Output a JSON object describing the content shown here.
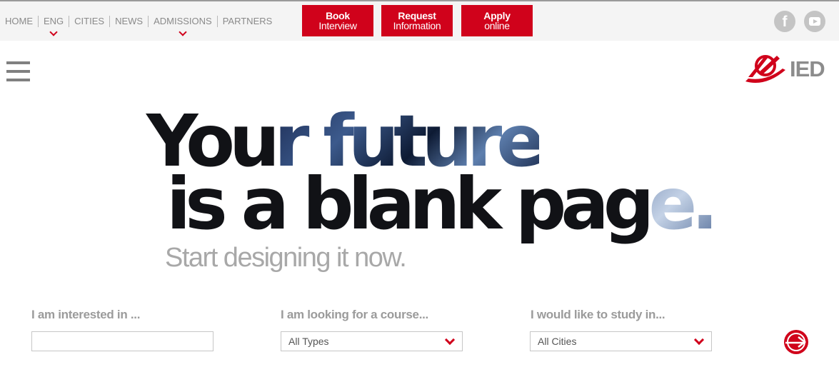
{
  "topbar": {
    "nav": [
      {
        "label": "HOME",
        "dropdown": false
      },
      {
        "label": "ENG",
        "dropdown": true
      },
      {
        "label": "CITIES",
        "dropdown": false
      },
      {
        "label": "NEWS",
        "dropdown": false
      },
      {
        "label": "ADMISSIONS",
        "dropdown": true
      },
      {
        "label": "PARTNERS",
        "dropdown": false
      }
    ],
    "cta": [
      {
        "line1": "Book",
        "line2": "Interview"
      },
      {
        "line1": "Request",
        "line2": "Information"
      },
      {
        "line1": "Apply",
        "line2": "online"
      }
    ],
    "social": {
      "facebook": "f"
    }
  },
  "brand": {
    "logo_text": "IED"
  },
  "hero": {
    "line1_a": "You",
    "line1_b": "r future",
    "line2_a": "is a blank pag",
    "line2_b": "e.",
    "subline": "Start designing it now."
  },
  "search": {
    "interest_label": "I am interested in ...",
    "interest_value": "",
    "course_label": "I am looking for a course...",
    "course_value": "All Types",
    "city_label": "I would like to study in...",
    "city_value": "All Cities"
  },
  "colors": {
    "accent": "#d0021b",
    "nav_text": "#8a8a8a",
    "headline": "#111216",
    "topbar_bg": "#f4f4f4"
  },
  "icons": {
    "facebook": "facebook-icon",
    "youtube": "youtube-icon",
    "menu": "hamburger-menu-icon",
    "go": "arrow-right-circle-icon"
  }
}
